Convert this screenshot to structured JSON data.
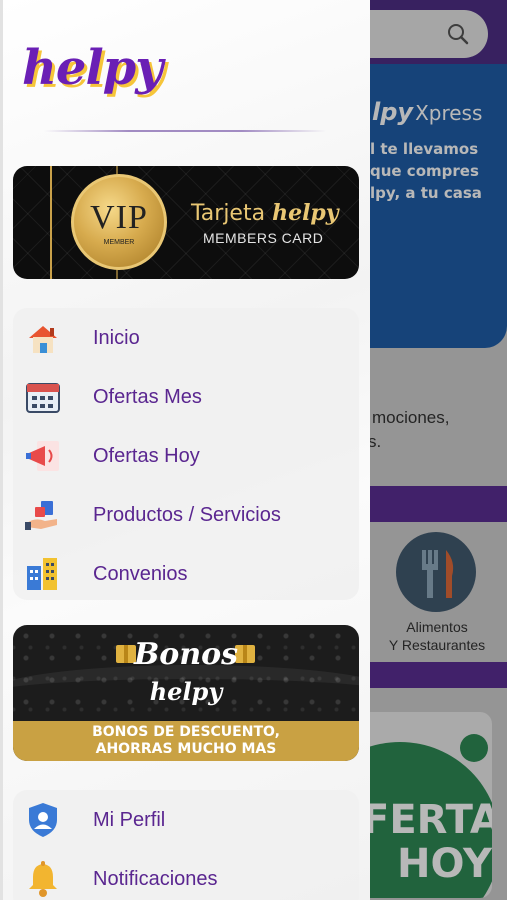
{
  "background": {
    "banner_brand": "lpy",
    "banner_brand_suffix": "Xpress",
    "banner_lines": [
      "l te llevamos",
      "que compres",
      "lpy, a tu casa"
    ],
    "promo_text_1": "mociones,",
    "promo_text_2": "s.",
    "category": {
      "label_1": "Alimentos",
      "label_2": "Y Restaurantes",
      "icon": "fork-knife-icon"
    },
    "ofertas_card": {
      "line_1": "FERTAS",
      "line_2": "HOY"
    }
  },
  "drawer": {
    "logo": "helpy",
    "vip_card": {
      "coin_text": "VIP",
      "coin_subtext": "MEMBER",
      "title_prefix": "Tarjeta",
      "title_brand": "helpy",
      "subtitle": "MEMBERS CARD"
    },
    "menu": [
      {
        "label": "Inicio",
        "icon": "home-icon"
      },
      {
        "label": "Ofertas Mes",
        "icon": "calendar-icon"
      },
      {
        "label": "Ofertas Hoy",
        "icon": "megaphone-icon"
      },
      {
        "label": "Productos / Servicios",
        "icon": "shopping-hand-icon"
      },
      {
        "label": "Convenios",
        "icon": "buildings-icon"
      }
    ],
    "bonos": {
      "title": "Bonos",
      "brand": "helpy",
      "line_1": "BONOS DE DESCUENTO,",
      "line_2": "AHORRAS MUCHO MAS"
    },
    "menu2": [
      {
        "label": "Mi Perfil",
        "icon": "user-shield-icon"
      },
      {
        "label": "Notificaciones",
        "icon": "bell-icon"
      }
    ]
  },
  "colors": {
    "brand_purple": "#5a2690",
    "accent_gold": "#c9a143",
    "background_blue": "#1f5ea8"
  }
}
